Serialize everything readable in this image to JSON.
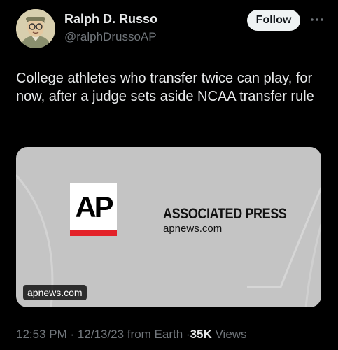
{
  "author": {
    "name": "Ralph D. Russo",
    "handle": "@ralphDrussoAP",
    "avatar_icon": "avatar-portrait-illustration"
  },
  "actions": {
    "follow_label": "Follow",
    "more_icon": "more-dots-icon"
  },
  "tweet": {
    "text": "College athletes who transfer twice can play, for now, after a judge sets aside NCAA transfer rule"
  },
  "card": {
    "logo_text": "AP",
    "brand": "ASSOCIATED PRESS",
    "domain": "apnews.com",
    "badge": "apnews.com",
    "background_color": "#c4c4c4",
    "logo_accent_color": "#e32229"
  },
  "meta": {
    "time": "12:53 PM",
    "separator": "·",
    "date": "12/13/23",
    "source": "from Earth",
    "views_count": "35K",
    "views_label": "Views"
  },
  "colors": {
    "background": "#000000",
    "text_primary": "#e7e9ea",
    "text_secondary": "#71767b",
    "follow_bg": "#eff3f4"
  }
}
